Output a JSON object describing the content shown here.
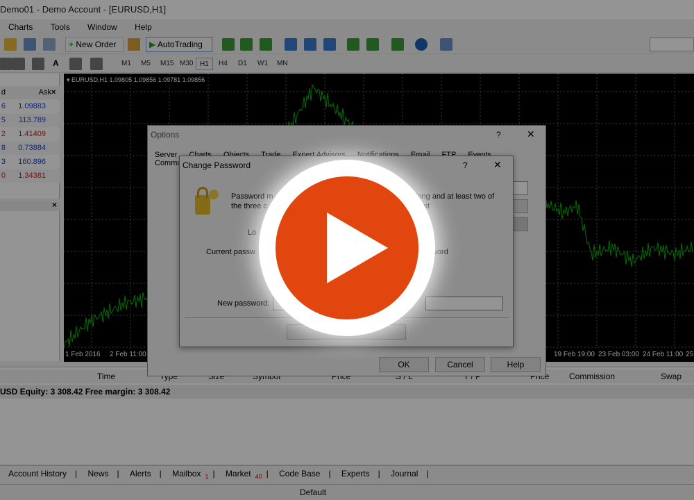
{
  "window": {
    "title": "Demo01 - Demo Account - [EURUSD,H1]"
  },
  "menu": [
    "Charts",
    "Tools",
    "Window",
    "Help"
  ],
  "toolbar": {
    "new_order": "New Order",
    "auto_trading": "AutoTrading"
  },
  "timeframes": [
    "M1",
    "M5",
    "M15",
    "M30",
    "H1",
    "H4",
    "D1",
    "W1",
    "MN"
  ],
  "market_watch": {
    "col_bid": "d",
    "col_ask": "Ask",
    "rows": [
      {
        "bid": "6",
        "ask": "1.09883",
        "color": "#1a3fd6"
      },
      {
        "bid": "5",
        "ask": "113.789",
        "color": "#1a3fd6"
      },
      {
        "bid": "2",
        "ask": "1.41409",
        "color": "#d61a1a"
      },
      {
        "bid": "8",
        "ask": "0.73884",
        "color": "#1a3fd6"
      },
      {
        "bid": "3",
        "ask": "160.896",
        "color": "#1a3fd6"
      },
      {
        "bid": "0",
        "ask": "1.34381",
        "color": "#d61a1a"
      }
    ]
  },
  "chart": {
    "label": "EURUSD,H1  1.09805 1.09856 1.09781 1.09856",
    "xticks_left": [
      "1 Feb 2016",
      "2 Feb 11:00"
    ],
    "xticks_right": [
      "19 Feb 19:00",
      "23 Feb 03:00",
      "24 Feb 11:00",
      "25"
    ],
    "line_color": "#00c000"
  },
  "terminal": {
    "headers": [
      "Time",
      "Type",
      "Size",
      "Symbol",
      "Price",
      "S / L",
      "T / P",
      "Price",
      "Commission",
      "Swap"
    ],
    "equity": "USD  Equity: 3 308.42  Free margin: 3 308.42",
    "tabs": [
      {
        "label": "Account History",
        "badge": ""
      },
      {
        "label": "News",
        "badge": ""
      },
      {
        "label": "Alerts",
        "badge": ""
      },
      {
        "label": "Mailbox",
        "badge": "1"
      },
      {
        "label": "Market",
        "badge": "40"
      },
      {
        "label": "Code Base",
        "badge": ""
      },
      {
        "label": "Experts",
        "badge": ""
      },
      {
        "label": "Journal",
        "badge": ""
      }
    ],
    "status": "Default"
  },
  "options_dialog": {
    "title": "Options",
    "help": "?",
    "close": "✕",
    "tabs": [
      "Server",
      "Charts",
      "Objects",
      "Trade",
      "Expert Advisors",
      "Notifications",
      "Email",
      "FTP",
      "Events",
      "Community"
    ],
    "ok": "OK",
    "cancel": "Cancel",
    "help_btn": "Help"
  },
  "change_password": {
    "title": "Change Password",
    "help": "?",
    "close": "✕",
    "message_a": "Password m",
    "message_b": "the three c",
    "message_c": "long and at least two of",
    "message_d": "digit",
    "login_label": "Lo",
    "current_label": "Current passw",
    "investor_label": "ssword",
    "new_label": "New password:"
  },
  "colors": {
    "accent": "#e0460e",
    "overlay": "rgba(0,0,0,0.42)"
  }
}
